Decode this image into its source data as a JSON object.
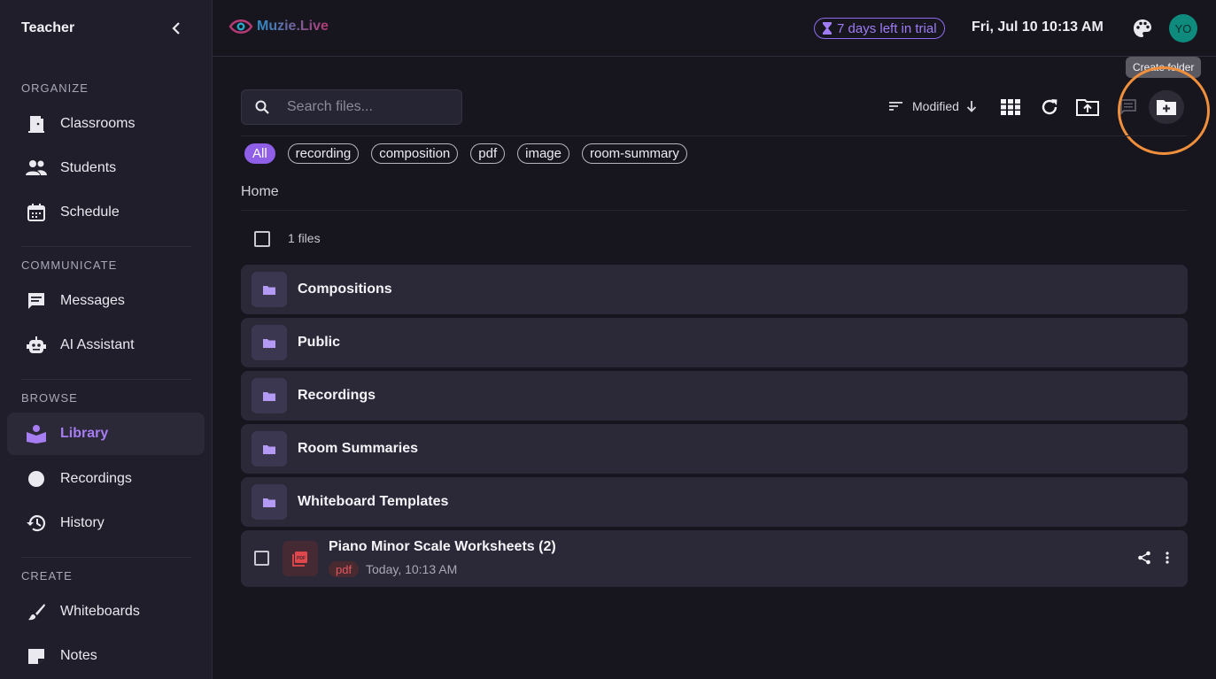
{
  "sidebar": {
    "title": "Teacher",
    "sections": [
      {
        "label": "ORGANIZE",
        "items": [
          {
            "label": "Classrooms",
            "icon": "door-icon"
          },
          {
            "label": "Students",
            "icon": "people-icon"
          },
          {
            "label": "Schedule",
            "icon": "calendar-icon"
          }
        ]
      },
      {
        "label": "COMMUNICATE",
        "items": [
          {
            "label": "Messages",
            "icon": "message-icon"
          },
          {
            "label": "AI Assistant",
            "icon": "robot-icon"
          }
        ]
      },
      {
        "label": "BROWSE",
        "items": [
          {
            "label": "Library",
            "icon": "library-icon",
            "active": true
          },
          {
            "label": "Recordings",
            "icon": "record-icon"
          },
          {
            "label": "History",
            "icon": "history-icon"
          }
        ]
      },
      {
        "label": "CREATE",
        "items": [
          {
            "label": "Whiteboards",
            "icon": "brush-icon"
          },
          {
            "label": "Notes",
            "icon": "note-icon"
          }
        ]
      }
    ]
  },
  "header": {
    "logo_text": "Muzie.Live",
    "trial_text": "7 days left in trial",
    "datetime": "Fri, Jul 10 10:13 AM",
    "avatar_initials": "YO"
  },
  "toolbar": {
    "search_placeholder": "Search files...",
    "sort_label": "Modified",
    "tooltip": "Create folder"
  },
  "filters": [
    "All",
    "recording",
    "composition",
    "pdf",
    "image",
    "room-summary"
  ],
  "breadcrumb": "Home",
  "file_count": "1 files",
  "folders": [
    "Compositions",
    "Public",
    "Recordings",
    "Room Summaries",
    "Whiteboard Templates"
  ],
  "files": [
    {
      "name": "Piano Minor Scale Worksheets (2)",
      "type": "pdf",
      "date": "Today, 10:13 AM"
    }
  ],
  "colors": {
    "accent": "#8f5fe8",
    "highlight": "#f08f3c",
    "avatar": "#0f8b7e"
  }
}
